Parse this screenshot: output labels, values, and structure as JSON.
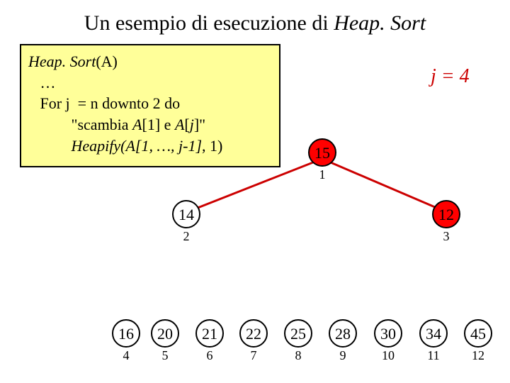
{
  "title_prefix": "Un esempio di esecuzione di ",
  "title_em": "Heap. Sort",
  "code": {
    "l1a": "Heap. Sort",
    "l1b": "(A)",
    "l2": "   …",
    "l3": "   For j  = n downto 2 do",
    "l4a": "           \"scambia ",
    "l4b": "A",
    "l4c": "[1] e ",
    "l4d": "A",
    "l4e": "[",
    "l4f": "j",
    "l4g": "]\"",
    "l5a": "           Heapify(A[1, …, j-1]",
    "l5b": ", 1)"
  },
  "j_label": "j = 4",
  "nodes": {
    "n1": "15",
    "n2": "14",
    "n3": "12",
    "n4": "16",
    "n5": "20",
    "n6": "21",
    "n7": "22",
    "n8": "25",
    "n9": "28",
    "n10": "30",
    "n11": "34",
    "n12": "45"
  },
  "idx": {
    "i1": "1",
    "i2": "2",
    "i3": "3",
    "i4": "4",
    "i5": "5",
    "i6": "6",
    "i7": "7",
    "i8": "8",
    "i9": "9",
    "i10": "10",
    "i11": "11",
    "i12": "12"
  },
  "chart_data": {
    "type": "diagram",
    "title": "Heap state during HeapSort, j=4",
    "heap_nodes": [
      {
        "index": 1,
        "value": 15,
        "fill": "red",
        "children": [
          2,
          3
        ]
      },
      {
        "index": 2,
        "value": 14,
        "fill": "white",
        "children": []
      },
      {
        "index": 3,
        "value": 12,
        "fill": "red",
        "children": []
      }
    ],
    "sorted_tail": [
      {
        "index": 4,
        "value": 16
      },
      {
        "index": 5,
        "value": 20
      },
      {
        "index": 6,
        "value": 21
      },
      {
        "index": 7,
        "value": 22
      },
      {
        "index": 8,
        "value": 25
      },
      {
        "index": 9,
        "value": 28
      },
      {
        "index": 10,
        "value": 30
      },
      {
        "index": 11,
        "value": 34
      },
      {
        "index": 12,
        "value": 45
      }
    ],
    "annotation": "j = 4"
  }
}
